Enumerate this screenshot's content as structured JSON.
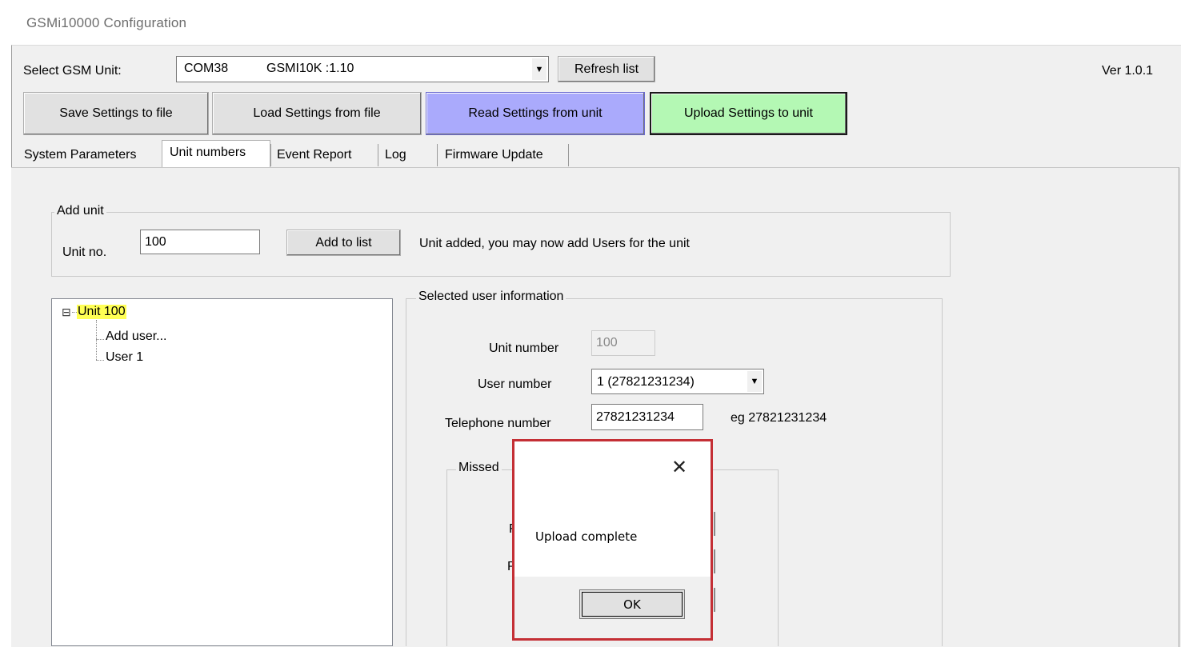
{
  "window": {
    "title": "GSMi10000 Configuration",
    "version": "Ver 1.0.1"
  },
  "toolbar": {
    "select_label": "Select GSM Unit:",
    "unit_port": "COM38",
    "unit_model": "GSMI10K :1.10",
    "refresh_label": "Refresh list",
    "save_label": "Save Settings to file",
    "load_label": "Load Settings from file",
    "read_label": "Read Settings from unit",
    "upload_label": "Upload Settings to unit",
    "read_color": "#aaaafc",
    "upload_color": "#b4f8b4"
  },
  "tabs": [
    {
      "label": "System Parameters"
    },
    {
      "label": "Unit numbers",
      "active": true
    },
    {
      "label": "Event Report"
    },
    {
      "label": "Log"
    },
    {
      "label": "Firmware Update"
    }
  ],
  "add_unit": {
    "group_title": "Add unit",
    "unit_no_label": "Unit no.",
    "unit_no_value": "100",
    "add_button": "Add to list",
    "status": "Unit added, you may now add Users for the unit"
  },
  "tree": {
    "root": {
      "label": "Unit 100",
      "toggle": "⊟",
      "highlight_color": "#ffff54"
    },
    "children": [
      {
        "label": "Add user..."
      },
      {
        "label": "User 1"
      }
    ]
  },
  "user_info": {
    "group_title": "Selected user information",
    "unit_number_label": "Unit number",
    "unit_number_value": "100",
    "user_number_label": "User number",
    "user_number_value": "1 (27821231234)",
    "telephone_label": "Telephone number",
    "telephone_value": "27821231234",
    "telephone_hint": "eg 27821231234",
    "missed_group_title": "Missed",
    "partial_labels": [
      "F",
      "P"
    ]
  },
  "dialog": {
    "message": "Upload complete",
    "ok_label": "OK",
    "close_icon": "close-icon",
    "border_color": "#c42f35"
  }
}
